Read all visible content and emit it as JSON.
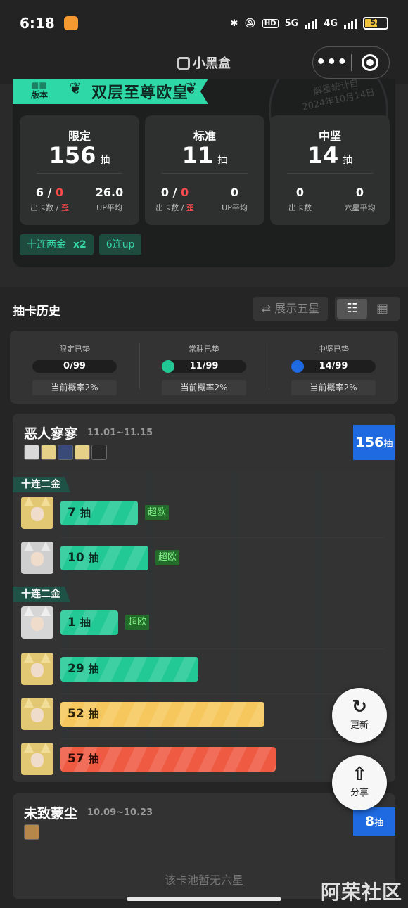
{
  "status": {
    "time": "6:18",
    "battery": "53",
    "net1": "5G",
    "net2": "4G",
    "hd": "HD"
  },
  "nav": {
    "title": "小黑盒",
    "more": "•••"
  },
  "summary": {
    "version_label": "版本",
    "title": "双层至尊欧皇",
    "stamp_line1": "解星统计自",
    "stamp_line2": "2024年10月14日",
    "stats": [
      {
        "label": "限定",
        "count": "156",
        "unit": "抽",
        "a_val": "6",
        "a_val2": "0",
        "a_key": "出卡数",
        "a_key2": "歪",
        "b_val": "26.0",
        "b_key": "UP平均"
      },
      {
        "label": "标准",
        "count": "11",
        "unit": "抽",
        "a_val": "0",
        "a_val2": "0",
        "a_key": "出卡数",
        "a_key2": "歪",
        "b_val": "0",
        "b_key": "UP平均"
      },
      {
        "label": "中坚",
        "count": "14",
        "unit": "抽",
        "a_val": "0",
        "a_key": "出卡数",
        "b_val": "0",
        "b_key": "六星平均"
      }
    ],
    "tags": [
      {
        "text": "十连两金",
        "mult": "x2"
      },
      {
        "text": "6连up"
      }
    ]
  },
  "history": {
    "title": "抽卡历史",
    "five_star_button": "⇄ 展示五星",
    "pity": [
      {
        "label": "限定已垫",
        "value": "0/99",
        "rate": "当前概率2%",
        "progress": 0,
        "color": "#1e1e1e"
      },
      {
        "label": "常驻已垫",
        "value": "11/99",
        "rate": "当前概率2%",
        "progress": 0.11,
        "color": "#23c995"
      },
      {
        "label": "中坚已垫",
        "value": "14/99",
        "rate": "当前概率2%",
        "progress": 0.14,
        "color": "#1f6ae0"
      }
    ]
  },
  "pools": [
    {
      "name": "恶人寥寥",
      "date": "11.01~11.15",
      "total": "156",
      "unit": "抽",
      "groups": [
        "十连二金",
        "十连二金"
      ],
      "pulls": [
        {
          "count": "7",
          "unit": "抽",
          "badge": "超欧",
          "color": "green",
          "pct": 0.28
        },
        {
          "count": "10",
          "unit": "抽",
          "badge": "超欧",
          "color": "green",
          "pct": 0.32
        },
        {
          "count": "1",
          "unit": "抽",
          "badge": "超欧",
          "color": "green",
          "pct": 0.2
        },
        {
          "count": "29",
          "unit": "抽",
          "badge": "",
          "color": "green",
          "pct": 0.5
        },
        {
          "count": "52",
          "unit": "抽",
          "badge": "",
          "color": "yellow",
          "pct": 0.74
        },
        {
          "count": "57",
          "unit": "抽",
          "badge": "",
          "color": "orange",
          "pct": 0.78
        }
      ]
    },
    {
      "name": "未致蒙尘",
      "date": "10.09~10.23",
      "total": "8",
      "unit": "抽",
      "empty": "该卡池暂无六星"
    }
  ],
  "fabs": {
    "refresh": "更新",
    "share": "分享",
    "refresh_icon": "↻",
    "share_icon": "⇧"
  },
  "watermark": "阿荣社区"
}
